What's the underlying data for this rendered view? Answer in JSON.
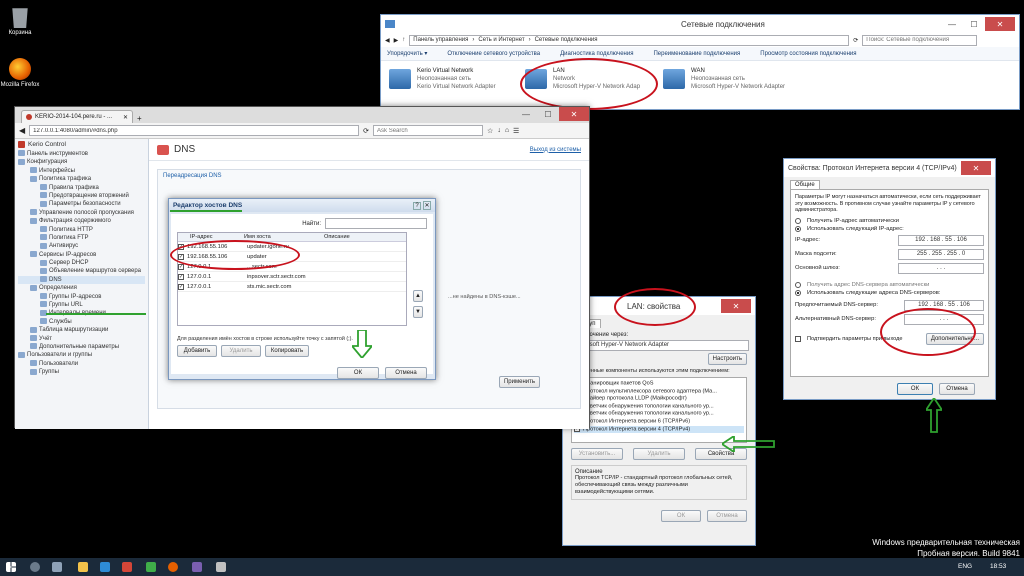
{
  "desktop": {
    "icons": [
      {
        "label": "Корзина",
        "color": "#9aa0a6"
      },
      {
        "label": "Mozilla Firefox",
        "color": "#e66000"
      }
    ],
    "watermark": {
      "line1": "Windows предварительная техническая",
      "line2": "Пробная версия. Build 9841"
    }
  },
  "net_connections": {
    "title": "Сетевые подключения",
    "breadcrumb": [
      "Панель управления",
      "Сеть и Интернет",
      "Сетевые подключения"
    ],
    "search_placeholder": "Поиск: Сетевые подключения",
    "toolbar": [
      "Упорядочить ▾",
      "Отключение сетевого устройства",
      "Диагностика подключения",
      "Переименование подключения",
      "Просмотр состояния подключения"
    ],
    "adapters": [
      {
        "name": "Kerio Virtual Network",
        "status": "Неопознанная сеть",
        "device": "Kerio Virtual Network Adapter"
      },
      {
        "name": "LAN",
        "status": "Network",
        "device": "Microsoft Hyper-V Network Adap"
      },
      {
        "name": "WAN",
        "status": "Неопознанная сеть",
        "device": "Microsoft Hyper-V Network Adapter"
      }
    ]
  },
  "browser": {
    "tab_title": "KERIO-2014-104.pere.ru - ...",
    "url": "127.0.0.1:4080/admin/#dns.php",
    "search_placeholder": "Ask Search",
    "app_name": "Kerio Control",
    "page_title": "DNS",
    "logout_link": "Выход из системы",
    "section_label": "Переадресация DNS",
    "apply_button": "Применить",
    "tree": [
      "Панель инструментов",
      "Конфигурация",
      "Интерфейсы",
      "Политика трафика",
      "Правила трафика",
      "Предотвращение вторжений",
      "Параметры безопасности",
      "Управление полосой пропускания",
      "Фильтрация содержимого",
      "Политика HTTP",
      "Политика FTP",
      "Антивирус",
      "Сервисы IP-адресов",
      "Сервер DHCP",
      "Объявление маршрутов сервера",
      "DNS",
      "Определения",
      "Группы IP-адресов",
      "Группы URL",
      "Интервалы времени",
      "Службы",
      "Таблица маршрутизации",
      "Учёт",
      "Дополнительные параметры",
      "Пользователи и группы",
      "Пользователи",
      "Группы"
    ],
    "tail_text": "...не найдены в DNS-кэше..."
  },
  "dns_dialog": {
    "title": "Редактор хостов DNS",
    "find_label": "Найти:",
    "columns": [
      "IP-адрес",
      "Имя хоста",
      "Описание"
    ],
    "rows": [
      {
        "ip": "192.168.55.106",
        "host": "updater.igone.ru"
      },
      {
        "ip": "192.168.55.106",
        "host": "updater"
      },
      {
        "ip": "127.0.0.1",
        "host": "...sectr.com"
      },
      {
        "ip": "127.0.0.1",
        "host": "inpsover.sctr.sectr.com"
      },
      {
        "ip": "127.0.0.1",
        "host": "sts.mic.sectr.com"
      }
    ],
    "hint": "Для разделения имён хостов в строке используйте точку с запятой (;).",
    "add": "Добавить",
    "delete": "Удалить",
    "copy": "Копировать",
    "ok": "ОК",
    "cancel": "Отмена"
  },
  "lan_props": {
    "title": "LAN: свойства",
    "tab": "Доступ",
    "connect_via": "Подключение через:",
    "adapter": "Microsoft Hyper-V Network Adapter",
    "configure": "Настроить",
    "components_label": "Отмеченные компоненты используются этим подключением:",
    "components": [
      "Планировщик пакетов QoS",
      "Протокол мультиплексора сетевого адаптера (Ма...",
      "Драйвер протокола LLDP (Майкрософт)",
      "Ответчик обнаружения топологии канального ур...",
      "Ответчик обнаружения топологии канального ур...",
      "Протокол Интернета версии 6 (TCP/IPv6)",
      "Протокол Интернета версии 4 (TCP/IPv4)"
    ],
    "install": "Установить...",
    "remove": "Удалить",
    "properties": "Свойства",
    "description_label": "Описание",
    "description": "Протокол TCP/IP - стандартный протокол глобальных сетей, обеспечивающий связь между различными взаимодействующими сетями.",
    "ok": "ОК",
    "cancel": "Отмена"
  },
  "ipv4_props": {
    "title": "Свойства: Протокол Интернета версии 4 (TCP/IPv4)",
    "tab": "Общие",
    "intro": "Параметры IP могут назначаться автоматически, если сеть поддерживает эту возможность. В противном случае узнайте параметры IP у сетевого администратора.",
    "auto_ip": "Получить IP-адрес автоматически",
    "manual_ip": "Использовать следующий IP-адрес:",
    "ip_label": "IP-адрес:",
    "ip": "192 . 168 . 55 . 106",
    "mask_label": "Маска подсети:",
    "mask": "255 . 255 . 255 . 0",
    "gw_label": "Основной шлюз:",
    "gw": ". . .",
    "auto_dns": "Получить адрес DNS-сервера автоматически",
    "manual_dns": "Использовать следующие адреса DNS-серверов:",
    "pref_dns_label": "Предпочитаемый DNS-сервер:",
    "pref_dns": "192 . 168 . 55 . 106",
    "alt_dns_label": "Альтернативный DNS-сервер:",
    "alt_dns": ". . .",
    "validate": "Подтвердить параметры при выходе",
    "advanced": "Дополнительно...",
    "ok": "ОК",
    "cancel": "Отмена"
  },
  "taskbar": {
    "lang": "ENG",
    "time": "18:53"
  },
  "colors": {
    "annotation_red": "#c8121d",
    "annotation_green": "#2fa12f",
    "kerio_tree_bg": "#f3f5f8"
  }
}
